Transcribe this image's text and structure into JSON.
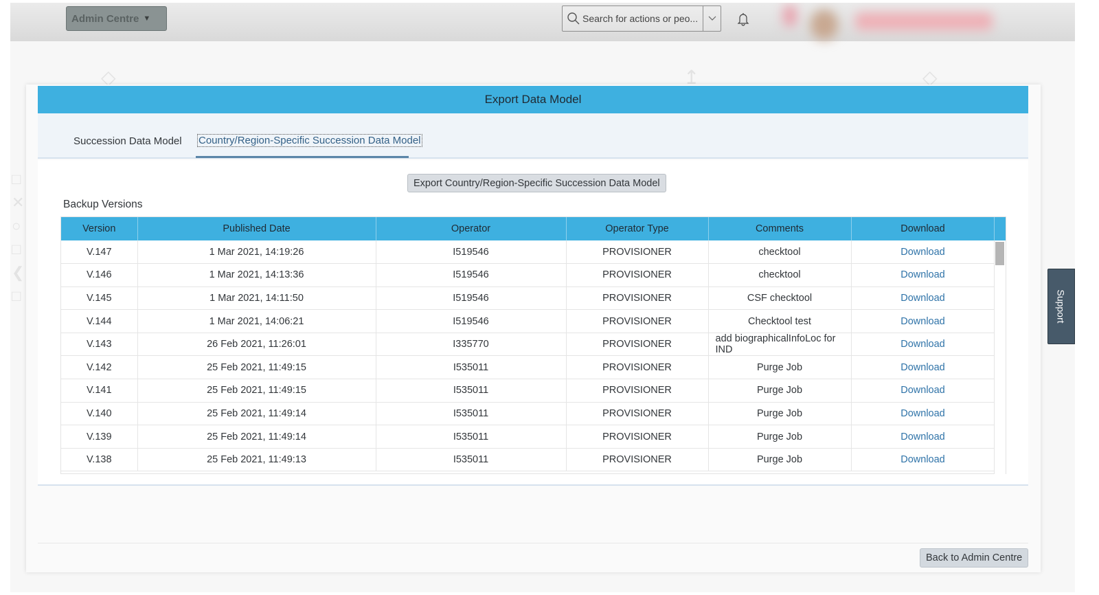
{
  "topbar": {
    "admin_menu_label": "Admin Centre",
    "search_placeholder": "Search for actions or peo...",
    "search_icon": "search-icon",
    "dropdown_icon": "chevron-down-icon",
    "notification_icon": "bell-icon"
  },
  "dialog": {
    "title": "Export Data Model",
    "tabs": [
      {
        "label": "Succession Data Model",
        "active": false
      },
      {
        "label": "Country/Region-Specific Succession Data Model",
        "active": true
      }
    ],
    "export_button_label": "Export Country/Region-Specific Succession Data Model",
    "section_title": "Backup Versions",
    "table": {
      "columns": [
        "Version",
        "Published Date",
        "Operator",
        "Operator Type",
        "Comments",
        "Download"
      ],
      "rows": [
        {
          "version": "V.147",
          "date": "1 Mar 2021, 14:19:26",
          "operator": "I519546",
          "operator_type": "PROVISIONER",
          "comments": "checktool",
          "download": "Download"
        },
        {
          "version": "V.146",
          "date": "1 Mar 2021, 14:13:36",
          "operator": "I519546",
          "operator_type": "PROVISIONER",
          "comments": "checktool",
          "download": "Download"
        },
        {
          "version": "V.145",
          "date": "1 Mar 2021, 14:11:50",
          "operator": "I519546",
          "operator_type": "PROVISIONER",
          "comments": "CSF checktool",
          "download": "Download"
        },
        {
          "version": "V.144",
          "date": "1 Mar 2021, 14:06:21",
          "operator": "I519546",
          "operator_type": "PROVISIONER",
          "comments": "Checktool test",
          "download": "Download"
        },
        {
          "version": "V.143",
          "date": "26 Feb 2021, 11:26:01",
          "operator": "I335770",
          "operator_type": "PROVISIONER",
          "comments": "add biographicalInfoLoc for IND",
          "download": "Download"
        },
        {
          "version": "V.142",
          "date": "25 Feb 2021, 11:49:15",
          "operator": "I535011",
          "operator_type": "PROVISIONER",
          "comments": "Purge Job",
          "download": "Download"
        },
        {
          "version": "V.141",
          "date": "25 Feb 2021, 11:49:15",
          "operator": "I535011",
          "operator_type": "PROVISIONER",
          "comments": "Purge Job",
          "download": "Download"
        },
        {
          "version": "V.140",
          "date": "25 Feb 2021, 11:49:14",
          "operator": "I535011",
          "operator_type": "PROVISIONER",
          "comments": "Purge Job",
          "download": "Download"
        },
        {
          "version": "V.139",
          "date": "25 Feb 2021, 11:49:14",
          "operator": "I535011",
          "operator_type": "PROVISIONER",
          "comments": "Purge Job",
          "download": "Download"
        },
        {
          "version": "V.138",
          "date": "25 Feb 2021, 11:49:13",
          "operator": "I535011",
          "operator_type": "PROVISIONER",
          "comments": "Purge Job",
          "download": "Download"
        }
      ]
    },
    "back_button_label": "Back to Admin Centre"
  },
  "support_tab_label": "Support",
  "colors": {
    "header_blue": "#3eb0e0",
    "link_blue": "#2f73a8",
    "support_bg": "#475a6a"
  }
}
